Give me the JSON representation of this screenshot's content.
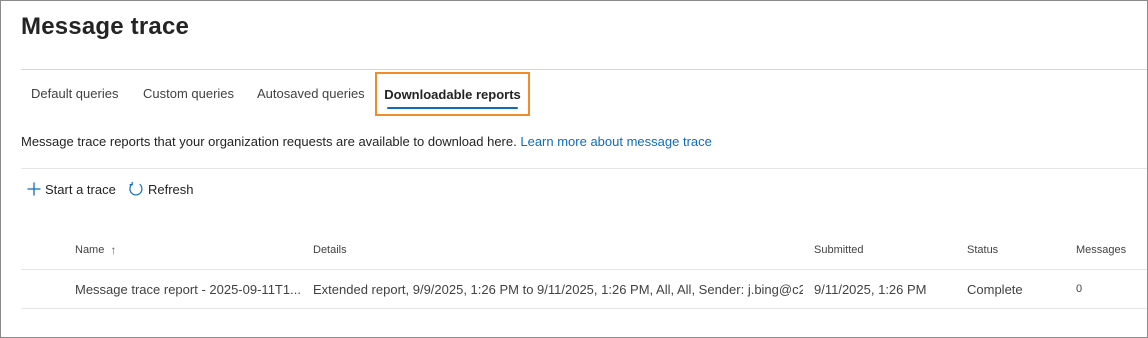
{
  "page": {
    "title": "Message trace"
  },
  "tabs": [
    {
      "label": "Default queries",
      "selected": false
    },
    {
      "label": "Custom queries",
      "selected": false
    },
    {
      "label": "Autosaved queries",
      "selected": false
    },
    {
      "label": "Downloadable reports",
      "selected": true
    }
  ],
  "description": {
    "text": "Message trace reports that your organization requests are available to download here.",
    "link": "Learn more about message trace"
  },
  "commands": {
    "start_trace": {
      "label": "Start a trace",
      "icon": "add-icon"
    },
    "refresh": {
      "label": "Refresh",
      "icon": "refresh-icon"
    }
  },
  "table": {
    "columns": {
      "name": "Name",
      "details": "Details",
      "submitted": "Submitted",
      "status": "Status",
      "messages": "Messages"
    },
    "sort_icon": "↑",
    "rows": [
      {
        "name": "Message trace report - 2025-09-11T1...",
        "details": "Extended report, 9/9/2025, 1:26 PM to 9/11/2025, 1:26 PM, All, All, Sender: j.bing@c2...",
        "submitted": "9/11/2025, 1:26 PM",
        "status": "Complete",
        "messages": "0"
      }
    ]
  },
  "colors": {
    "accent": "#0f6cbd",
    "highlight_border": "#f28c28",
    "text": "#242424"
  }
}
